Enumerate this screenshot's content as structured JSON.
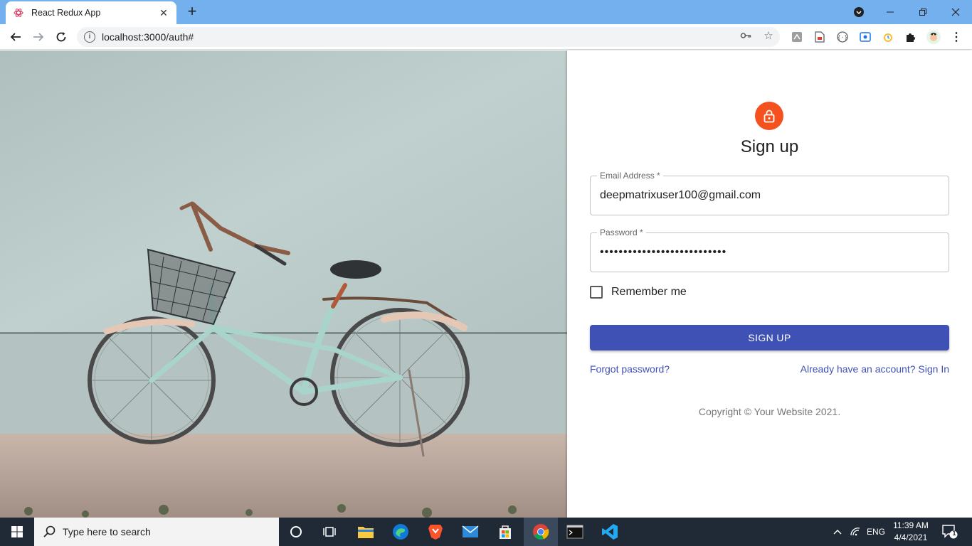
{
  "browser": {
    "tab_title": "React Redux App",
    "new_tab_symbol": "+",
    "url": "localhost:3000/auth#",
    "window_controls": [
      "minimize",
      "restore",
      "close"
    ]
  },
  "auth_form": {
    "heading": "Sign up",
    "email_label": "Email Address *",
    "email_value": "deepmatrixuser100@gmail.com",
    "password_label": "Password *",
    "password_value": "•••••••••••••••••••••••••••",
    "remember_label": "Remember me",
    "remember_checked": false,
    "submit_label": "SIGN UP",
    "forgot_link": "Forgot password?",
    "signin_link": "Already have an account? Sign In",
    "copyright": "Copyright © Your Website 2021."
  },
  "taskbar": {
    "search_placeholder": "Type here to search",
    "language": "ENG",
    "time": "11:39 AM",
    "date": "4/4/2021",
    "notification_count": "1",
    "apps": [
      "task-view",
      "widgets",
      "file-explorer",
      "edge",
      "brave",
      "mail",
      "store",
      "chrome",
      "terminal",
      "vscode"
    ]
  },
  "colors": {
    "accent": "#3f51b5",
    "avatar": "#f4511e",
    "tabbar": "#74b0ee",
    "taskbar": "#1f2a36"
  }
}
